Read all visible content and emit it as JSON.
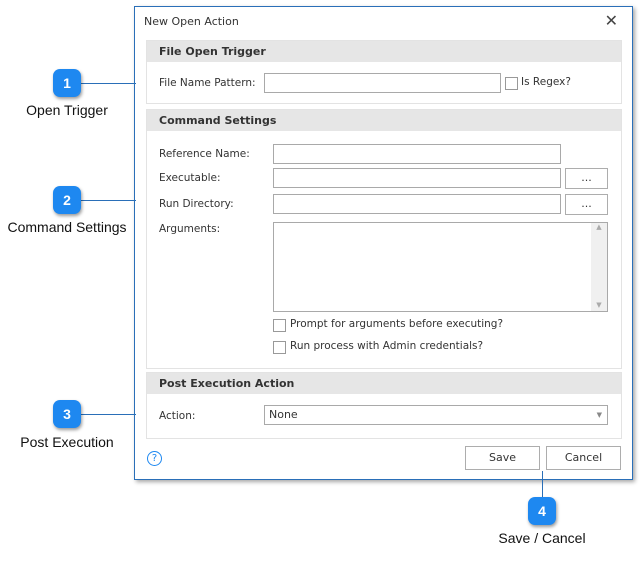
{
  "dialog": {
    "title": "New Open Action",
    "close_icon": "close-icon"
  },
  "trigger": {
    "header": "File Open Trigger",
    "pattern_label": "File Name Pattern:",
    "pattern_value": "",
    "regex_label": "Is Regex?",
    "regex_checked": false
  },
  "command": {
    "header": "Command Settings",
    "ref_label": "Reference Name:",
    "ref_value": "",
    "exe_label": "Executable:",
    "exe_value": "",
    "browse_label": "...",
    "dir_label": "Run Directory:",
    "dir_value": "",
    "args_label": "Arguments:",
    "args_value": "",
    "prompt_label": "Prompt for arguments before executing?",
    "admin_label": "Run process with Admin credentials?"
  },
  "post": {
    "header": "Post Execution Action",
    "action_label": "Action:",
    "action_value": "None"
  },
  "footer": {
    "help": "?",
    "save": "Save",
    "cancel": "Cancel"
  },
  "callouts": [
    {
      "n": "1",
      "text": "Open Trigger"
    },
    {
      "n": "2",
      "text": "Command Settings"
    },
    {
      "n": "3",
      "text": "Post Execution"
    },
    {
      "n": "4",
      "text": "Save / Cancel"
    }
  ],
  "colors": {
    "accent": "#1e88f0",
    "border": "#2a6fb8"
  }
}
